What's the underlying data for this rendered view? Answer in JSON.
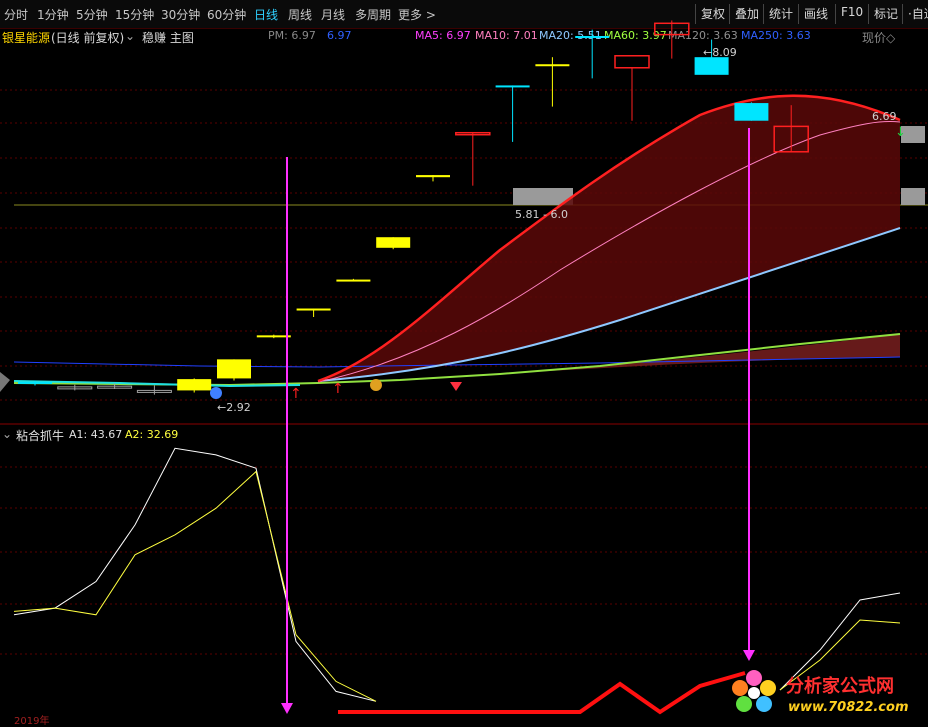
{
  "periods": [
    {
      "label": "分时",
      "active": false
    },
    {
      "label": "1分钟",
      "active": false
    },
    {
      "label": "5分钟",
      "active": false
    },
    {
      "label": "15分钟",
      "active": false
    },
    {
      "label": "30分钟",
      "active": false
    },
    {
      "label": "60分钟",
      "active": false
    },
    {
      "label": "日线",
      "active": true
    },
    {
      "label": "周线",
      "active": false
    },
    {
      "label": "月线",
      "active": false
    },
    {
      "label": "多周期",
      "active": false
    },
    {
      "label": "更多 >",
      "active": false
    }
  ],
  "tools": {
    "restore": "复权",
    "overlay": "叠加",
    "stats": "统计",
    "draw": "画线",
    "f10": "F10",
    "mark": "标记",
    "auto": "·自适"
  },
  "main": {
    "stock_name": "银星能源",
    "mode": "(日线 前复权)",
    "template": "稳赚 主图",
    "pm_label": "PM: 6.97",
    "pm_value": "6.97",
    "ma5": "MA5: 6.97",
    "ma10": "MA10: 7.01",
    "ma20": "MA20: 5.51",
    "ma60": "MA60: 3.97",
    "ma120": "MA120: 3.63",
    "ma250": "MA250: 3.63",
    "current_price": "现价◇",
    "high_label": "8.09",
    "right_label": "6.69",
    "range_label": "5.81 - 6.0",
    "low_label": "2.92"
  },
  "sub": {
    "title": "粘合抓牛",
    "a1": "A1: 43.67",
    "a2": "A2: 32.69",
    "date_hint": "2019年"
  },
  "watermark": {
    "name": "分析家公式网",
    "url": "www.70822.com"
  },
  "colors": {
    "up": "#ff2020",
    "down": "#00e5ff",
    "yellow": "#ffff00",
    "magenta": "#ff40ff",
    "ma20": "#8ec8ff",
    "ma60": "#a0ff40"
  },
  "candles": [
    {
      "o": 3.1,
      "h": 3.12,
      "l": 3.05,
      "c": 3.08,
      "color": "cyan"
    },
    {
      "o": 3.02,
      "h": 3.06,
      "l": 2.98,
      "c": 3.03,
      "color": "gray"
    },
    {
      "o": 3.03,
      "h": 3.08,
      "l": 3.0,
      "c": 3.04,
      "color": "gray"
    },
    {
      "o": 2.98,
      "h": 3.05,
      "l": 2.92,
      "c": 2.96,
      "color": "gray"
    },
    {
      "o": 2.98,
      "h": 3.15,
      "l": 2.95,
      "c": 3.14,
      "color": "yellow"
    },
    {
      "o": 3.15,
      "h": 3.42,
      "l": 3.12,
      "c": 3.42,
      "color": "yellow"
    },
    {
      "o": 3.75,
      "h": 3.77,
      "l": 3.72,
      "c": 3.76,
      "color": "yellow"
    },
    {
      "o": 4.12,
      "h": 4.14,
      "l": 4.02,
      "c": 4.14,
      "color": "yellow"
    },
    {
      "o": 4.55,
      "h": 4.56,
      "l": 4.54,
      "c": 4.55,
      "color": "yellow"
    },
    {
      "o": 5.0,
      "h": 5.15,
      "l": 4.98,
      "c": 5.15,
      "color": "yellow"
    },
    {
      "o": 6.0,
      "h": 6.03,
      "l": 5.94,
      "c": 6.03,
      "color": "yellow"
    },
    {
      "o": 6.63,
      "h": 6.64,
      "l": 5.88,
      "c": 6.63,
      "color": "red"
    },
    {
      "o": 7.3,
      "h": 7.3,
      "l": 6.5,
      "c": 7.3,
      "color": "cyan"
    },
    {
      "o": 7.6,
      "h": 7.7,
      "l": 7.0,
      "c": 7.6,
      "color": "yellow"
    },
    {
      "o": 8.0,
      "h": 8.09,
      "l": 7.4,
      "c": 8.0,
      "color": "cyan"
    },
    {
      "o": 7.55,
      "h": 7.55,
      "l": 6.8,
      "c": 7.72,
      "color": "red"
    },
    {
      "o": 8.02,
      "h": 8.22,
      "l": 7.68,
      "c": 8.18,
      "color": "red"
    },
    {
      "o": 7.7,
      "h": 7.95,
      "l": 7.5,
      "c": 7.45,
      "color": "cyan"
    },
    {
      "o": 7.05,
      "h": 7.06,
      "l": 6.8,
      "c": 6.8,
      "color": "cyan"
    },
    {
      "o": 6.72,
      "h": 7.02,
      "l": 6.36,
      "c": 6.36,
      "color": "red"
    }
  ],
  "a1_series": [
    28,
    30,
    38,
    55,
    78,
    76,
    72,
    20,
    5,
    2,
    2,
    2,
    2,
    2,
    2,
    2,
    5,
    12,
    18,
    28,
    30
  ],
  "a2_series": [
    29,
    30,
    28,
    46,
    52,
    60,
    71,
    22,
    8,
    2,
    2,
    2,
    2,
    2,
    2,
    2,
    5,
    10,
    16,
    22,
    22
  ]
}
